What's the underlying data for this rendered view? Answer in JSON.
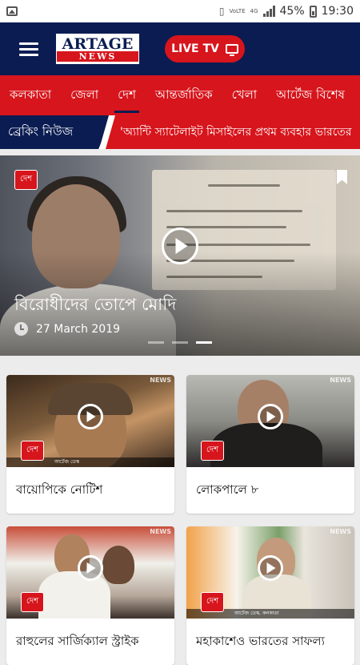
{
  "status_bar": {
    "volte": "VoLTE",
    "network": "4G",
    "battery": "45%",
    "time": "19:30"
  },
  "app_bar": {
    "logo_top": "ARTAGE",
    "logo_bottom": "NEWS",
    "live_tv_label": "LIVE TV"
  },
  "tabs": [
    {
      "label": "কলকাতা",
      "active": false
    },
    {
      "label": "জেলা",
      "active": false
    },
    {
      "label": "দেশ",
      "active": true
    },
    {
      "label": "আন্তর্জাতিক",
      "active": false
    },
    {
      "label": "খেলা",
      "active": false
    },
    {
      "label": "আর্টেজ বিশেষ",
      "active": false
    }
  ],
  "breaking": {
    "label": "ব্রেকিং নিউজ",
    "headline": "'অ্যান্টি স্যাটেলাইট মিসাইলের প্রথম ব্যবহার ভারতের"
  },
  "hero": {
    "category": "দেশ",
    "title": "বিরোধীদের তোপে মোদি",
    "date": "27 March 2019",
    "slide_count": 3,
    "active_slide": 3
  },
  "cards": [
    {
      "category": "দেশ",
      "title": "বায়োপিকে নোটিশ",
      "thumb_logo": "NEWS",
      "strip_text": "আর্টেজ ডেস্ক"
    },
    {
      "category": "দেশ",
      "title": "লোকপালে ৮",
      "thumb_logo": "NEWS",
      "strip_text": ""
    },
    {
      "category": "দেশ",
      "title": "রাহুলের সার্জিক্যাল স্ট্রাইক",
      "thumb_logo": "NEWS",
      "strip_text": ""
    },
    {
      "category": "দেশ",
      "title": "মহাকাশেও ভারতের সাফল্য",
      "thumb_logo": "NEWS",
      "strip_text": "আর্টেজ ডেস্ক, কলকাতা"
    }
  ],
  "colors": {
    "navy": "#0b1c52",
    "red": "#d7151c"
  }
}
